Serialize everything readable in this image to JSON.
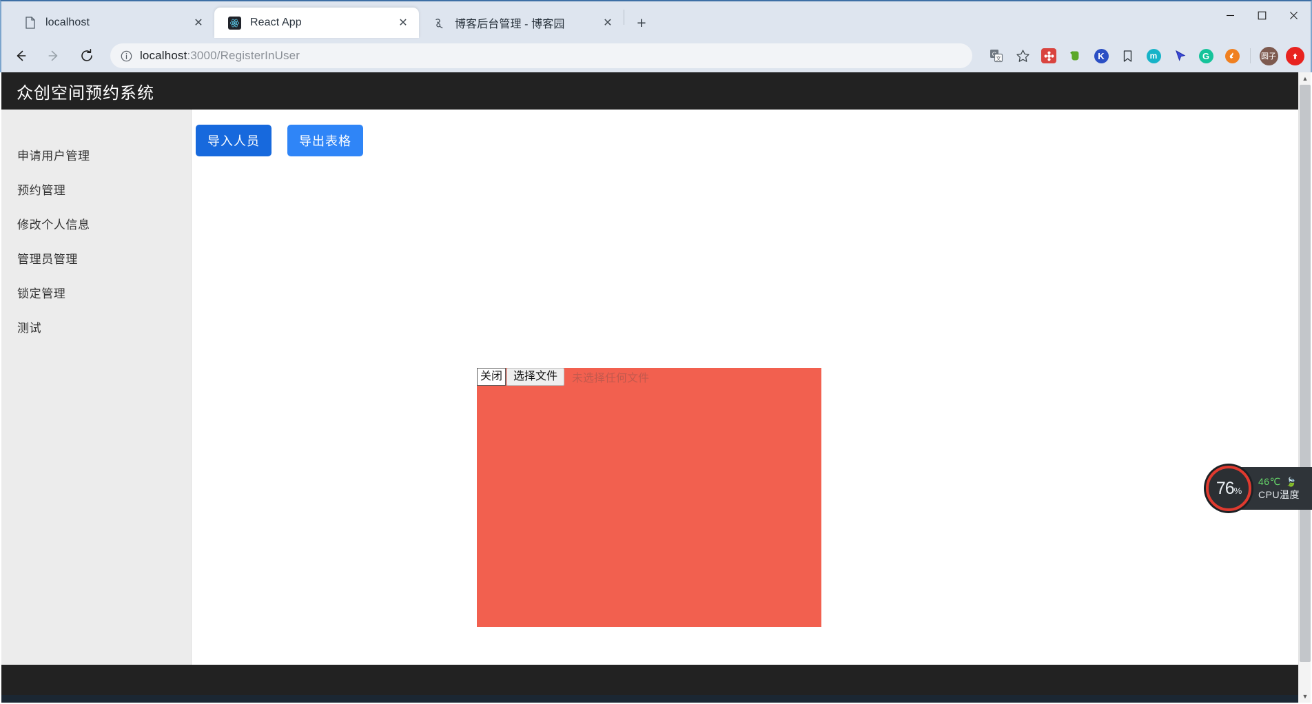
{
  "browser": {
    "tabs": [
      {
        "title": "localhost",
        "favicon": "page-icon",
        "active": false
      },
      {
        "title": "React App",
        "favicon": "react-icon",
        "active": true
      },
      {
        "title": "博客后台管理 - 博客园",
        "favicon": "cnblogs-icon",
        "active": false
      }
    ],
    "new_tab_label": "+",
    "close_label": "✕",
    "nav": {
      "back": "←",
      "forward": "→",
      "reload": "⟳"
    },
    "omnibox": {
      "info_icon": "info-circle-icon",
      "url_host": "localhost",
      "url_path": ":3000/RegisterInUser",
      "translate_icon": "translate-icon",
      "bookmark_icon": "star-icon"
    },
    "extensions": [
      {
        "name": "screenshot-extension",
        "glyph": "❀",
        "color": "#d9443f"
      },
      {
        "name": "evernote-extension",
        "glyph": "",
        "color": "#4caf50"
      },
      {
        "name": "kingsoft-extension",
        "glyph": "K",
        "color": "#2b4fc4"
      },
      {
        "name": "bookmark-manager-extension",
        "glyph": "",
        "color": "#ffffff"
      },
      {
        "name": "metamask-extension",
        "glyph": "m",
        "color": "#17b3c8"
      },
      {
        "name": "cursor-tool-extension",
        "glyph": "",
        "color": "#3b4ad8"
      },
      {
        "name": "grammarly-extension",
        "glyph": "G",
        "color": "#15c39a"
      },
      {
        "name": "fire-extension",
        "glyph": "",
        "color": "#f08020"
      }
    ],
    "profiles": [
      {
        "name": "profile-avatar-yuanzi",
        "label": "圆子",
        "color": "#7d5a4f"
      },
      {
        "name": "profile-avatar-red",
        "label": "",
        "color": "#e8231f"
      }
    ],
    "window_controls": {
      "minimize": "minimize-icon",
      "maximize": "maximize-icon",
      "close": "close-icon"
    }
  },
  "app": {
    "title": "众创空间预约系统",
    "sidebar": {
      "items": [
        {
          "label": "申请用户管理"
        },
        {
          "label": "预约管理"
        },
        {
          "label": "修改个人信息"
        },
        {
          "label": "管理员管理"
        },
        {
          "label": "锁定管理"
        },
        {
          "label": "测试"
        }
      ]
    },
    "toolbar": {
      "import_label": "导入人员",
      "export_label": "导出表格",
      "import_color": "#1769dd",
      "export_color": "#2f85f7"
    },
    "upload_dialog": {
      "close_label": "关闭",
      "choose_file_label": "选择文件",
      "no_file_label": "未选择任何文件",
      "panel_color": "#f2604f"
    }
  },
  "scrollbar": {
    "up_arrow": "▲",
    "down_arrow": "▼"
  },
  "cpu_widget": {
    "usage": "76",
    "usage_sign": "%",
    "temperature": "46℃",
    "label": "CPU温度",
    "leaf_icon": "leaf-icon",
    "ring_color": "#e03a2f"
  }
}
